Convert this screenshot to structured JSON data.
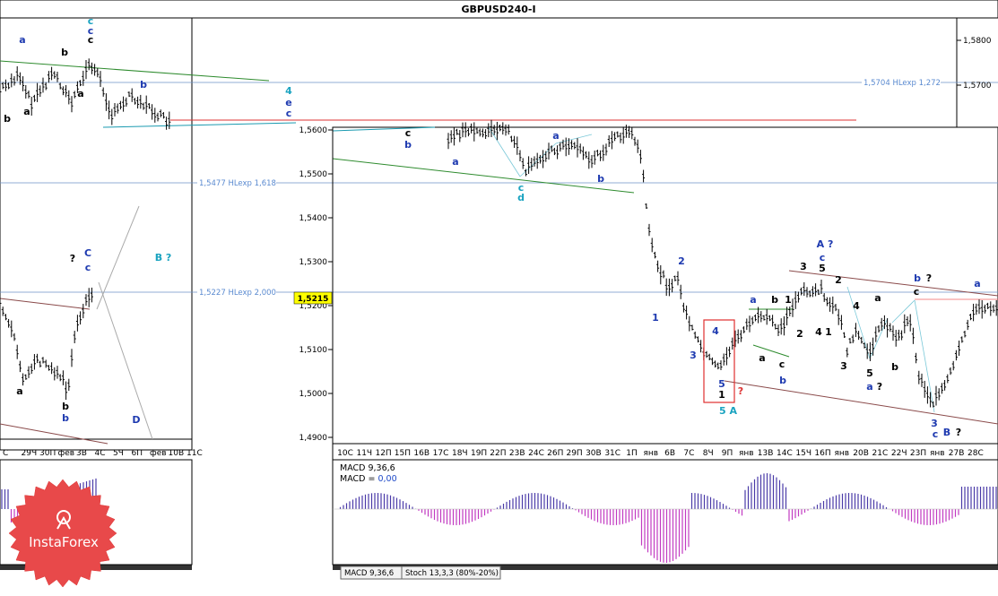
{
  "chart_data": {
    "type": "candlestick",
    "title": "GBPUSD240-I",
    "current_price": "1,5215",
    "y_ticks_main": [
      "1,5600",
      "1,5500",
      "1,5400",
      "1,5300",
      "1,5200",
      "1,5100",
      "1,5000",
      "1,4900"
    ],
    "y_ticks_top": [
      "1,5800",
      "1,5700"
    ],
    "x_ticks_main": [
      "10С",
      "11Ч",
      "12П",
      "15П",
      "16В",
      "17С",
      "18Ч",
      "19П",
      "22П",
      "23В",
      "24С",
      "26П",
      "29П",
      "30В",
      "31С",
      "1П",
      "янв",
      "6В",
      "7С",
      "8Ч",
      "9П",
      "янв",
      "13В",
      "14С",
      "15Ч",
      "16П",
      "янв",
      "20В",
      "21С",
      "22Ч",
      "23П",
      "янв",
      "27В",
      "28С"
    ],
    "x_ticks_left": [
      "С",
      "29Ч",
      "30П",
      "фев",
      "3В",
      "4С",
      "5Ч",
      "6П",
      "фев",
      "10В",
      "11С"
    ],
    "levels": [
      {
        "label": "1,5704 HLexp 1,272",
        "value": 1.5704
      },
      {
        "label": "1,5477 HLexp 1,618",
        "value": 1.5477
      },
      {
        "label": "1,5227 HLexp 2,000",
        "value": 1.5227
      }
    ],
    "wave_labels": [
      "a",
      "c",
      "c",
      "b",
      "b",
      "a",
      "c",
      "4",
      "e",
      "c",
      "b",
      "a",
      "b",
      "d",
      "c",
      "?",
      "C",
      "c",
      "B ?",
      "D",
      "1",
      "2",
      "3",
      "4",
      "5",
      "1",
      "5 A",
      "?",
      "a",
      "b",
      "1",
      "a",
      "b",
      "A ?",
      "c",
      "3",
      "5",
      "2",
      "4",
      "1",
      "3",
      "a",
      "4",
      "5",
      "b",
      "a ?",
      "b ?",
      "c",
      "3",
      "c B ?",
      "a",
      "b",
      "a",
      "b",
      "d"
    ]
  },
  "macd": {
    "title": "MACD 9,36,6",
    "value_prefix": "MACD = ",
    "value": "0,00"
  },
  "tabs": [
    "MACD 9,36,6",
    "Stoch 13,3,3 (80%-20%)"
  ],
  "logo": "InstaForex"
}
